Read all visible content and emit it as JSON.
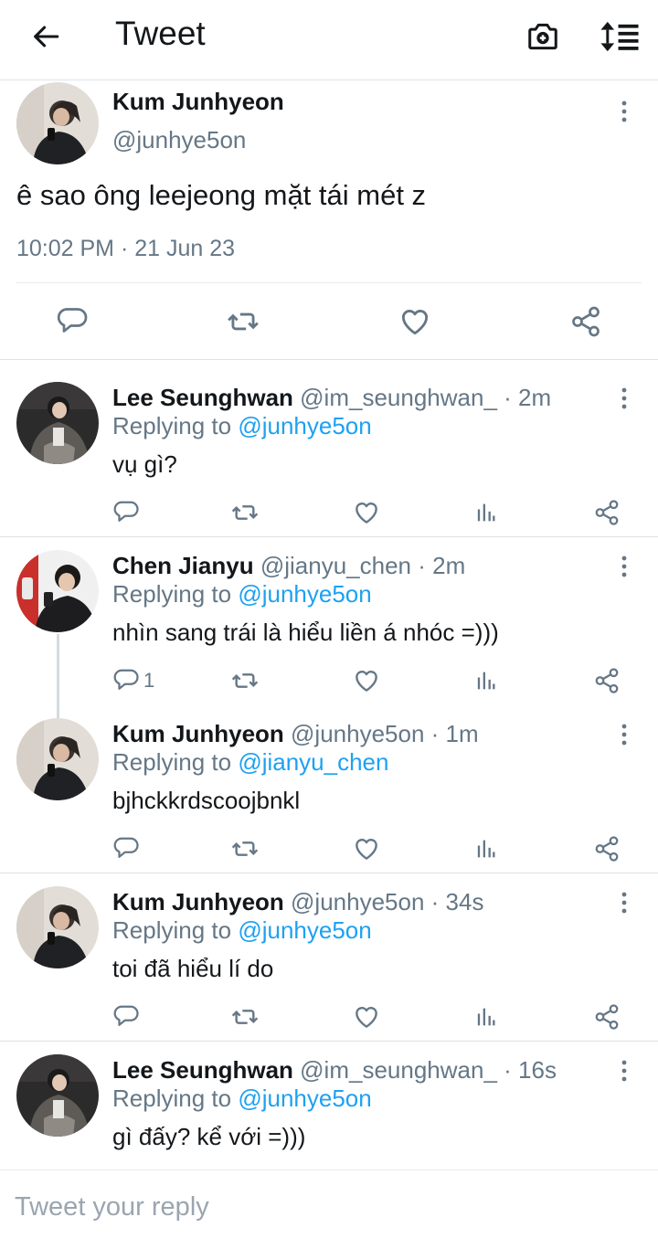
{
  "header": {
    "title": "Tweet",
    "back_icon": "arrow-left-icon",
    "camera_icon": "camera-add-icon",
    "sort_icon": "sort-icon"
  },
  "main_tweet": {
    "name": "Kum Junhyeon",
    "handle": "@junhye5on",
    "text": "ê sao ông leejeong mặt tái mét z",
    "timestamp": "10:02 PM · 21 Jun 23"
  },
  "replies": [
    {
      "name": "Lee Seunghwan",
      "handle": "@im_seunghwan_",
      "time": "· 2m",
      "replying_prefix": "Replying to ",
      "replying_to": "@junhye5on",
      "text": "vụ gì?",
      "reply_count": ""
    },
    {
      "name": "Chen Jianyu",
      "handle": "@jianyu_chen",
      "time": "· 2m",
      "replying_prefix": "Replying to ",
      "replying_to": "@junhye5on",
      "text": "nhìn sang trái là hiểu liền á nhóc =)))",
      "reply_count": "1"
    },
    {
      "name": "Kum Junhyeon",
      "handle": "@junhye5on",
      "time": "· 1m",
      "replying_prefix": "Replying to ",
      "replying_to": "@jianyu_chen",
      "text": "bjhckkrdscoojbnkl",
      "reply_count": ""
    },
    {
      "name": "Kum Junhyeon",
      "handle": "@junhye5on",
      "time": "· 34s",
      "replying_prefix": "Replying to ",
      "replying_to": "@junhye5on",
      "text": "toi đã hiểu lí do",
      "reply_count": ""
    },
    {
      "name": "Lee Seunghwan",
      "handle": "@im_seunghwan_",
      "time": "· 16s",
      "replying_prefix": "Replying to ",
      "replying_to": "@junhye5on",
      "text": "gì đấy? kể với =)))",
      "reply_count": ""
    }
  ],
  "composer": {
    "placeholder": "Tweet your reply"
  },
  "colors": {
    "accent": "#1da1f2",
    "secondary_text": "#657786",
    "divider": "#dfe2e5"
  }
}
